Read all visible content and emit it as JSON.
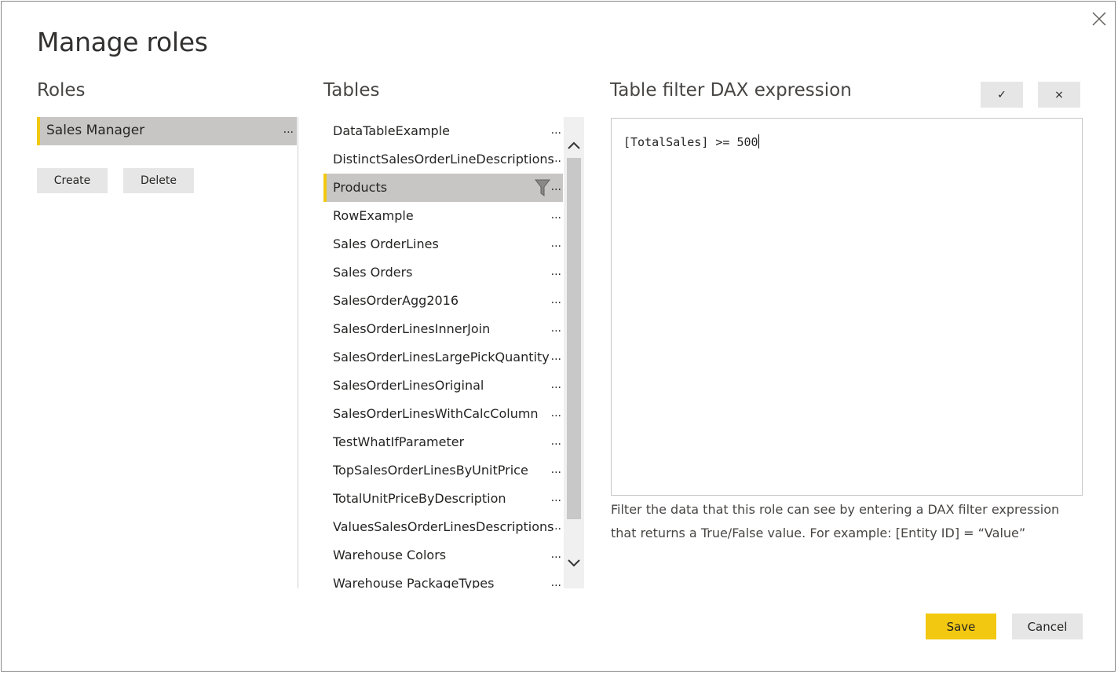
{
  "dialog": {
    "title": "Manage roles",
    "close_icon": "close-icon"
  },
  "roles": {
    "heading": "Roles",
    "items": [
      {
        "label": "Sales Manager",
        "selected": true,
        "more": "..."
      }
    ],
    "create_label": "Create",
    "delete_label": "Delete"
  },
  "tables": {
    "heading": "Tables",
    "items": [
      {
        "label": "DataTableExample",
        "more": "..."
      },
      {
        "label": "DistinctSalesOrderLineDescriptions",
        "more": "..."
      },
      {
        "label": "Products",
        "more": "...",
        "selected": true,
        "has_filter": true
      },
      {
        "label": "RowExample",
        "more": "..."
      },
      {
        "label": "Sales OrderLines",
        "more": "..."
      },
      {
        "label": "Sales Orders",
        "more": "..."
      },
      {
        "label": "SalesOrderAgg2016",
        "more": "..."
      },
      {
        "label": "SalesOrderLinesInnerJoin",
        "more": "..."
      },
      {
        "label": "SalesOrderLinesLargePickQuantity",
        "more": "..."
      },
      {
        "label": "SalesOrderLinesOriginal",
        "more": "..."
      },
      {
        "label": "SalesOrderLinesWithCalcColumn",
        "more": "..."
      },
      {
        "label": "TestWhatIfParameter",
        "more": "..."
      },
      {
        "label": "TopSalesOrderLinesByUnitPrice",
        "more": "..."
      },
      {
        "label": "TotalUnitPriceByDescription",
        "more": "..."
      },
      {
        "label": "ValuesSalesOrderLinesDescriptions",
        "more": "..."
      },
      {
        "label": "Warehouse Colors",
        "more": "..."
      },
      {
        "label": "Warehouse PackageTypes",
        "more": "..."
      }
    ]
  },
  "dax": {
    "heading": "Table filter DAX expression",
    "accept_label": "✓",
    "discard_label": "×",
    "expression": "[TotalSales] >= 500",
    "hint": "Filter the data that this role can see by entering a DAX filter expression that returns a True/False value. For example: [Entity ID] = “Value”"
  },
  "footer": {
    "save_label": "Save",
    "cancel_label": "Cancel"
  },
  "colors": {
    "accent": "#f2c811",
    "selected_bg": "#c8c6c4",
    "button_bg": "#e6e6e6"
  }
}
